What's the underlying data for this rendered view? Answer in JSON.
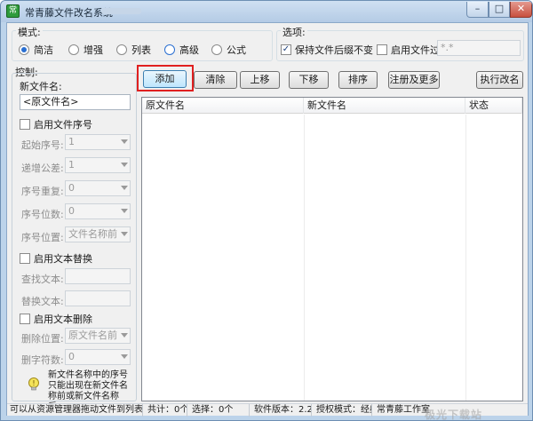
{
  "window": {
    "title": "常青藤文件改名系统",
    "controls": {
      "minimize": "–",
      "maximize": "□",
      "close": "✕"
    },
    "icon": "app-icon"
  },
  "mode": {
    "label": "模式:",
    "options": [
      {
        "label": "简洁",
        "selected": true
      },
      {
        "label": "增强",
        "selected": false
      },
      {
        "label": "列表",
        "selected": false
      },
      {
        "label": "高级",
        "selected": false
      },
      {
        "label": "公式",
        "selected": false
      }
    ]
  },
  "options": {
    "label": "选项:",
    "keep_ext": {
      "label": "保持文件后缀不变",
      "checked": true
    },
    "filter": {
      "label": "启用文件过滤",
      "checked": false,
      "value": "*.*"
    }
  },
  "control": {
    "label": "控制:",
    "new_name_label": "新文件名:",
    "new_name_value": "<原文件名>",
    "seq": {
      "enable_label": "启用文件序号",
      "start_label": "起始序号:",
      "start_value": "1",
      "step_label": "递增公差:",
      "step_value": "1",
      "repeat_label": "序号重复:",
      "repeat_value": "0",
      "digits_label": "序号位数:",
      "digits_value": "0",
      "position_label": "序号位置:",
      "position_value": "文件名称前"
    },
    "replace": {
      "enable_label": "启用文本替换",
      "find_label": "查找文本:",
      "replace_label": "替换文本:"
    },
    "delete": {
      "enable_label": "启用文本删除",
      "position_label": "删除位置:",
      "position_value": "原文件名前",
      "count_label": "删字符数:",
      "count_value": "0"
    },
    "tip": "新文件名称中的序号只能出现在新文件名称前或新文件名称后。"
  },
  "toolbar": {
    "add": "添加",
    "clear": "清除",
    "up": "上移",
    "down": "下移",
    "sort": "排序",
    "register": "注册及更多",
    "execute": "执行改名"
  },
  "list": {
    "columns": [
      "原文件名",
      "新文件名",
      "状态"
    ]
  },
  "status": {
    "hint": "可以从资源管理器拖动文件到列表",
    "total": "共计：0个",
    "selected": "选择：0个",
    "version": "软件版本：2.20",
    "license": "授权模式：经典",
    "brand": "常青藤工作室"
  },
  "watermark": "极光下载站 xz7.com",
  "colors": {
    "accent": "#2a6fd1",
    "highlight": "#e02020",
    "titlebar": "#bcd3ea"
  }
}
